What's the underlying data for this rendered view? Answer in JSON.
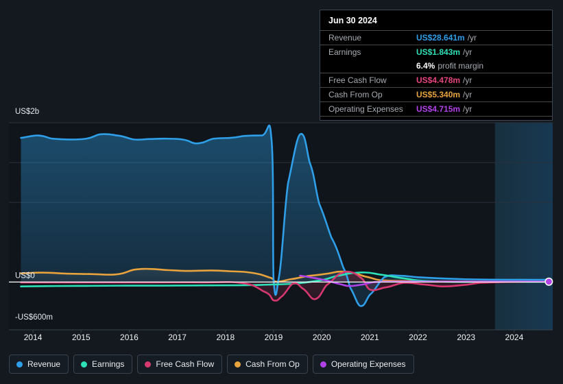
{
  "tooltip": {
    "date": "Jun 30 2024",
    "rows": [
      {
        "name": "Revenue",
        "value": "US$28.641m",
        "unit": "/yr",
        "color": "#2e9fe8"
      },
      {
        "name": "Earnings",
        "value": "US$1.843m",
        "unit": "/yr",
        "color": "#2ee0b8"
      },
      {
        "name": "",
        "value": "6.4%",
        "unit": "profit margin",
        "color": "#ffffff"
      },
      {
        "name": "Free Cash Flow",
        "value": "US$4.478m",
        "unit": "/yr",
        "color": "#e5447f"
      },
      {
        "name": "Cash From Op",
        "value": "US$5.340m",
        "unit": "/yr",
        "color": "#e8a33d"
      },
      {
        "name": "Operating Expenses",
        "value": "US$4.715m",
        "unit": "/yr",
        "color": "#b042e8"
      }
    ]
  },
  "legend": {
    "items": [
      {
        "label": "Revenue",
        "color": "#2e9fe8"
      },
      {
        "label": "Earnings",
        "color": "#2ee0b8"
      },
      {
        "label": "Free Cash Flow",
        "color": "#d6386f"
      },
      {
        "label": "Cash From Op",
        "color": "#e8a33d"
      },
      {
        "label": "Operating Expenses",
        "color": "#b042e8"
      }
    ]
  },
  "chart_data": {
    "type": "area",
    "title": "",
    "xlabel": "",
    "ylabel": "",
    "ylim": [
      -600,
      2000
    ],
    "y_unit": "US$ millions",
    "y_ticks": [
      {
        "value": 2000,
        "label": "US$2b"
      },
      {
        "value": 0,
        "label": "US$0"
      },
      {
        "value": -600,
        "label": "-US$600m"
      }
    ],
    "gridlines": [
      2000,
      1500,
      1000,
      0
    ],
    "grid": true,
    "legend_position": "bottom",
    "x_ticks": [
      "2014",
      "2015",
      "2016",
      "2017",
      "2018",
      "2019",
      "2020",
      "2021",
      "2022",
      "2023",
      "2024"
    ],
    "x_range": [
      "2013.5",
      "2024.8"
    ],
    "forecast_region": {
      "start": "2023.6",
      "end": "2024.8",
      "shaded": true
    },
    "series": [
      {
        "name": "Revenue",
        "color": "#2e9fe8",
        "fill": true,
        "x": [
          2013.75,
          2014.1,
          2014.4,
          2014.75,
          2015.1,
          2015.4,
          2015.75,
          2016.1,
          2016.4,
          2016.75,
          2017.1,
          2017.4,
          2017.75,
          2018.1,
          2018.4,
          2018.75,
          2018.95,
          2019.0,
          2019.1,
          2019.3,
          2019.55,
          2019.75,
          2019.95,
          2020.2,
          2020.45,
          2020.6,
          2020.8,
          2021.0,
          2021.3,
          2021.6,
          2022.0,
          2022.5,
          2023.0,
          2023.5,
          2024.0,
          2024.5,
          2024.72
        ],
        "y": [
          1810,
          1840,
          1800,
          1790,
          1800,
          1855,
          1840,
          1790,
          1795,
          1800,
          1790,
          1740,
          1800,
          1810,
          1835,
          1840,
          1830,
          30,
          25,
          1240,
          1855,
          1500,
          980,
          560,
          180,
          -80,
          -300,
          -160,
          60,
          80,
          60,
          45,
          35,
          30,
          29,
          28.6,
          28.641
        ]
      },
      {
        "name": "Earnings",
        "color": "#2ee0b8",
        "fill": false,
        "x": [
          2013.75,
          2014.5,
          2015.2,
          2016.0,
          2016.8,
          2017.6,
          2018.4,
          2019.0,
          2019.4,
          2019.9,
          2020.3,
          2020.6,
          2020.9,
          2021.2,
          2021.6,
          2022.0,
          2022.5,
          2023.0,
          2023.6,
          2024.2,
          2024.72
        ],
        "y": [
          -55,
          -50,
          -48,
          -45,
          -45,
          -42,
          -40,
          -30,
          -20,
          15,
          75,
          110,
          120,
          95,
          55,
          20,
          5,
          2,
          2,
          2,
          1.843
        ]
      },
      {
        "name": "Free Cash Flow",
        "color": "#d6386f",
        "fill": true,
        "x": [
          2013.75,
          2014.5,
          2015.5,
          2016.5,
          2017.5,
          2018.3,
          2018.8,
          2019.0,
          2019.15,
          2019.4,
          2019.6,
          2019.85,
          2020.1,
          2020.35,
          2020.55,
          2020.8,
          2021.0,
          2021.3,
          2021.7,
          2022.1,
          2022.5,
          2022.9,
          2023.3,
          2023.8,
          2024.3,
          2024.72
        ],
        "y": [
          -5,
          -5,
          -5,
          -5,
          -5,
          -10,
          -120,
          -230,
          -190,
          -20,
          -80,
          -215,
          -40,
          95,
          130,
          60,
          -95,
          -70,
          -10,
          -30,
          -55,
          -40,
          -10,
          0,
          4,
          4.478
        ]
      },
      {
        "name": "Cash From Op",
        "color": "#e8a33d",
        "fill": true,
        "x": [
          2013.75,
          2014.2,
          2014.7,
          2015.2,
          2015.7,
          2016.1,
          2016.4,
          2016.8,
          2017.2,
          2017.7,
          2018.1,
          2018.5,
          2018.9,
          2019.05,
          2019.35,
          2019.7,
          2020.05,
          2020.35,
          2020.6,
          2020.9,
          2021.2,
          2021.6,
          2022.0,
          2022.5,
          2023.0,
          2023.6,
          2024.2,
          2024.72
        ],
        "y": [
          110,
          118,
          105,
          100,
          95,
          155,
          165,
          150,
          140,
          145,
          135,
          120,
          60,
          5,
          35,
          75,
          100,
          130,
          120,
          70,
          25,
          15,
          10,
          8,
          6,
          5,
          5,
          5.34
        ]
      },
      {
        "name": "Operating Expenses",
        "color": "#b042e8",
        "fill": false,
        "x": [
          2019.55,
          2019.8,
          2020.05,
          2020.3,
          2020.55,
          2020.8,
          2021.1,
          2021.5,
          2022.0,
          2022.6,
          2023.2,
          2023.8,
          2024.3,
          2024.72
        ],
        "y": [
          80,
          55,
          25,
          -15,
          -50,
          -35,
          0,
          5,
          5,
          5,
          5,
          5,
          5,
          4.715
        ]
      }
    ],
    "end_marker": {
      "series": "Operating Expenses",
      "x": 2024.72,
      "y": 4.715,
      "color": "#b042e8"
    }
  },
  "colors": {
    "background": "#14191f",
    "plot_background": "#10151b",
    "forecast_background": "#152637",
    "gridline": "#2a323c",
    "zero_line": "#ffffff",
    "axis_line": "#39424d"
  }
}
